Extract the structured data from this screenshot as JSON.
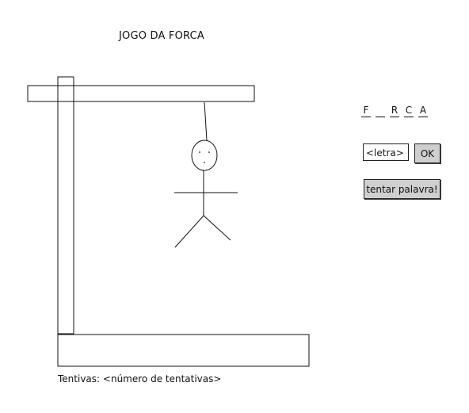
{
  "title": "JOGO DA FORCA",
  "word": {
    "letters": [
      "F",
      "",
      "R",
      "C",
      "A"
    ]
  },
  "input": {
    "placeholder": "<letra>"
  },
  "buttons": {
    "ok": "OK",
    "guess_word": "tentar palavra!"
  },
  "status": {
    "attempts_label": "Tentivas:",
    "attempts_value": "<número de tentativas>"
  },
  "icons": [
    "gallows-icon",
    "hanged-man-icon"
  ],
  "colors": {
    "button_bg": "#cfcfcf",
    "stroke": "#111111",
    "background": "#ffffff"
  }
}
